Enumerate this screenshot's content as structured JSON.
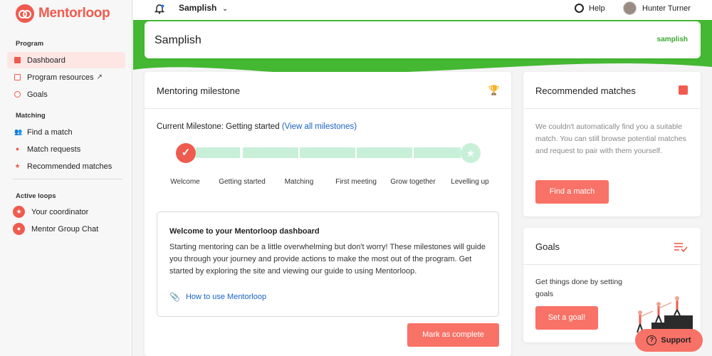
{
  "brand": {
    "name": "Mentorloop"
  },
  "sidebar": {
    "sections": {
      "program": "Program",
      "matching": "Matching",
      "active_loops": "Active loops"
    },
    "program_items": [
      {
        "label": "Dashboard",
        "icon": "dashboard-icon"
      },
      {
        "label": "Program resources",
        "icon": "book-icon",
        "external": "↗"
      },
      {
        "label": "Goals",
        "icon": "target-icon"
      }
    ],
    "matching_items": [
      {
        "label": "Find a match",
        "icon": "people-icon"
      },
      {
        "label": "Match requests",
        "icon": "user-request-icon"
      },
      {
        "label": "Recommended matches",
        "icon": "star-icon"
      }
    ],
    "loops": [
      {
        "label": "Your coordinator"
      },
      {
        "label": "Mentor Group Chat"
      }
    ]
  },
  "topbar": {
    "program": "Samplish",
    "help": "Help",
    "user": "Hunter Turner"
  },
  "program_card": {
    "title": "Samplish",
    "logo_text": "samplish"
  },
  "milestone": {
    "title": "Mentoring milestone",
    "current_label": "Current Milestone:",
    "current_value": "Getting started",
    "view_all": "(View all milestones)",
    "steps": [
      "Welcome",
      "Getting started",
      "Matching",
      "First meeting",
      "Grow together",
      "Levelling up"
    ],
    "welcome_title": "Welcome to your Mentorloop dashboard",
    "welcome_text": "Starting mentoring can be a little overwhelming but don't worry! These milestones will guide you through your journey and provide actions to make the most out of the program. Get started by exploring the site and viewing our guide to using Mentorloop.",
    "how_to": "How to use Mentorloop",
    "mark_complete": "Mark as complete"
  },
  "recommended": {
    "title": "Recommended matches",
    "text": "We couldn't automatically find you a suitable match. You can still browse potential matches and request to pair with them yourself.",
    "button": "Find a match"
  },
  "goals": {
    "title": "Goals",
    "text": "Get things done by setting goals",
    "button": "Set a goal!"
  },
  "support": {
    "label": "Support"
  },
  "colors": {
    "accent": "#f05b4f",
    "green": "#44b832",
    "milestone_pending": "#c8f0d8",
    "link": "#1a62c6"
  }
}
